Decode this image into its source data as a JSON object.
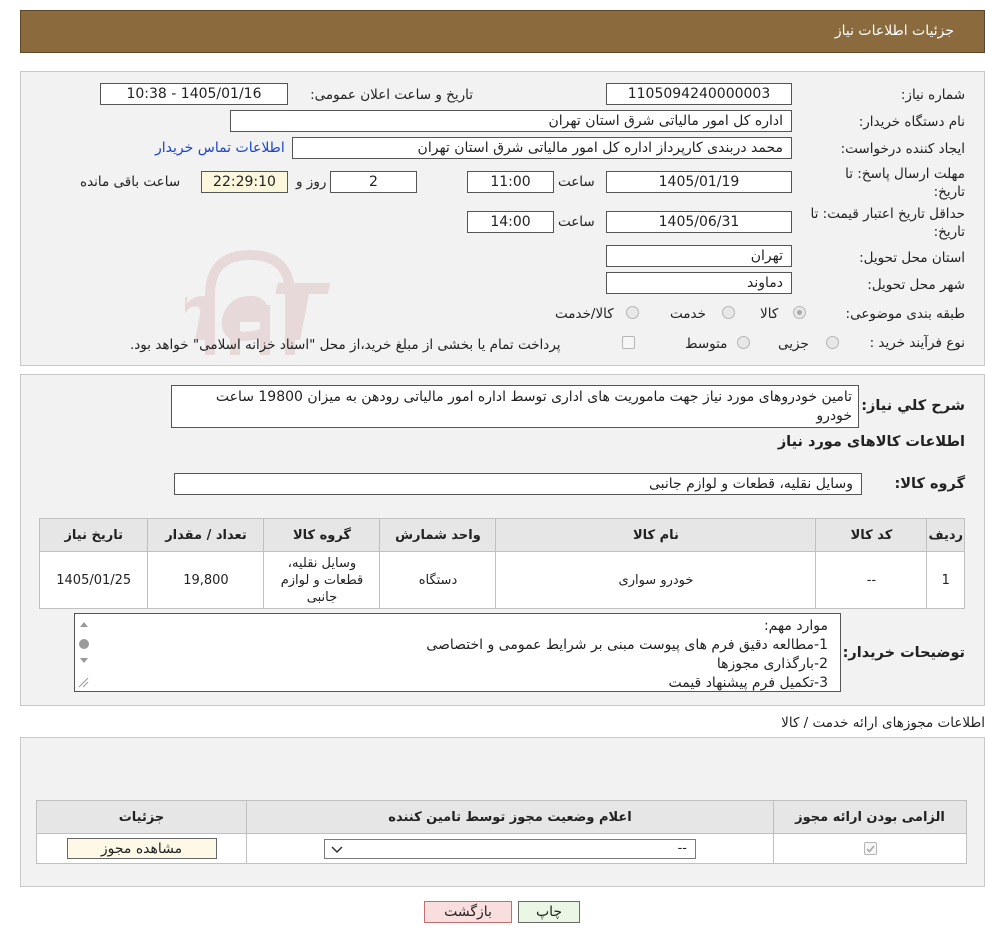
{
  "header": {
    "title": "جزئیات اطلاعات نیاز"
  },
  "watermark": {
    "text": "AriaTender.neT",
    "color": "#c99a9a"
  },
  "form": {
    "need_number_label": "شماره نیاز:",
    "need_number": "1105094240000003",
    "announce_label": "تاریخ و ساعت اعلان عمومی:",
    "announce_value": "1405/01/16 - 10:38",
    "buyer_label": "نام دستگاه خریدار:",
    "buyer_value": "اداره کل امور مالیاتی شرق استان تهران",
    "creator_label": "ایجاد کننده درخواست:",
    "creator_value": "محمد دربندی کارپرداز اداره کل امور مالیاتی شرق استان تهران",
    "contact_link": "اطلاعات تماس خریدار",
    "deadline_label_1": "مهلت ارسال پاسخ: تا",
    "deadline_label_2": "تاریخ:",
    "deadline_date": "1405/01/19",
    "time_label": "ساعت",
    "deadline_time": "11:00",
    "days_value": "2",
    "days_label": "روز و",
    "remaining_time": "22:29:10",
    "remaining_label": "ساعت باقی مانده",
    "validity_label_1": "حداقل تاریخ اعتبار قیمت: تا",
    "validity_label_2": "تاریخ:",
    "validity_date": "1405/06/31",
    "validity_time": "14:00",
    "province_label": "استان محل تحویل:",
    "province_value": "تهران",
    "city_label": "شهر محل تحویل:",
    "city_value": "دماوند",
    "category_label": "طبقه بندی موضوعی:",
    "category_options": [
      "کالا",
      "خدمت",
      "کالا/خدمت"
    ],
    "category_selected": "کالا",
    "process_label": "نوع فرآیند خرید :",
    "process_options": [
      "جزیی",
      "متوسط"
    ],
    "process_note": "پرداخت تمام یا بخشی از مبلغ خرید،از محل \"اسناد خزانه اسلامی\" خواهد بود."
  },
  "summary": {
    "label": "شرح کلي نياز:",
    "text": "تامین خودروهای مورد نیاز جهت ماموریت های اداری توسط اداره امور مالیاتی رودهن به میزان 19800 ساعت خودرو",
    "goods_info_title": "اطلاعات کالاهای مورد نیاز",
    "group_label": "گروه کالا:",
    "group_value": "وسایل نقلیه، قطعات و لوازم جانبی"
  },
  "goods_table": {
    "headers": [
      "ردیف",
      "کد کالا",
      "نام کالا",
      "واحد شمارش",
      "گروه کالا",
      "تعداد / مقدار",
      "تاریخ نیاز"
    ],
    "rows": [
      [
        "1",
        "--",
        "خودرو سواری",
        "دستگاه",
        "وسایل نقلیه، قطعات و لوازم جانبی",
        "19,800",
        "1405/01/25"
      ]
    ]
  },
  "buyer_notes": {
    "label": "توضیحات خریدار:",
    "lines": [
      "موارد مهم:",
      "1-مطالعه دقیق فرم های پیوست مبنی بر شرایط عمومی و اختصاصی",
      "2-بارگذاری مجوزها",
      "3-تکمیل فرم پیشنهاد قیمت"
    ]
  },
  "permits": {
    "title": "اطلاعات مجوزهای ارائه خدمت / کالا",
    "headers": [
      "الزامی بودن ارائه مجوز",
      "اعلام وضعیت مجوز توسط تامین کننده",
      "جزئیات"
    ],
    "select_value": "--",
    "view_button": "مشاهده مجوز"
  },
  "actions": {
    "print": "چاپ",
    "back": "بازگشت"
  }
}
